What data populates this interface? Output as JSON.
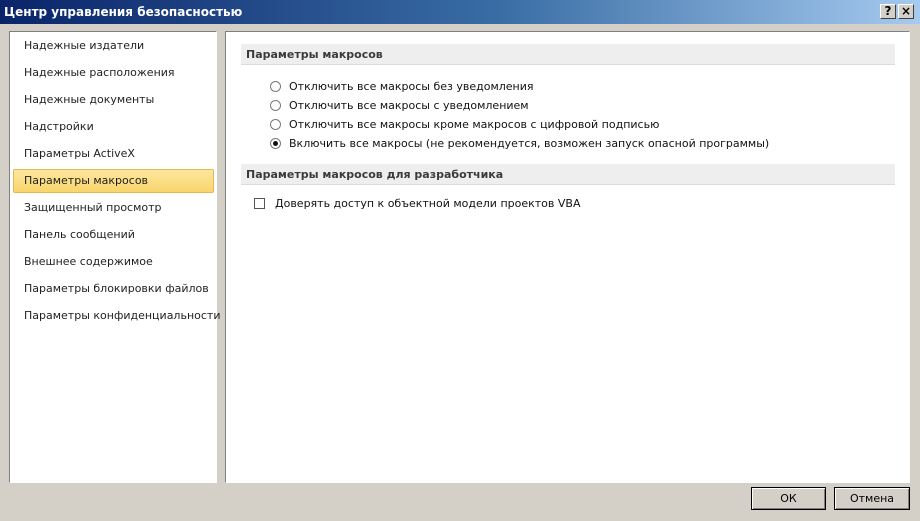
{
  "window": {
    "title": "Центр управления безопасностью",
    "help_label": "?",
    "close_label": "×"
  },
  "sidebar": {
    "items": [
      {
        "label": "Надежные издатели"
      },
      {
        "label": "Надежные расположения"
      },
      {
        "label": "Надежные документы"
      },
      {
        "label": "Надстройки"
      },
      {
        "label": "Параметры ActiveX"
      },
      {
        "label": "Параметры макросов",
        "selected": true
      },
      {
        "label": "Защищенный просмотр"
      },
      {
        "label": "Панель сообщений"
      },
      {
        "label": "Внешнее содержимое"
      },
      {
        "label": "Параметры блокировки файлов"
      },
      {
        "label": "Параметры конфиденциальности"
      }
    ]
  },
  "macro_settings": {
    "header": "Параметры макросов",
    "options": [
      {
        "label": "Отключить все макросы без уведомления",
        "checked": false
      },
      {
        "label": "Отключить все макросы с уведомлением",
        "checked": false
      },
      {
        "label": "Отключить все макросы кроме макросов с цифровой подписью",
        "checked": false
      },
      {
        "label": "Включить все макросы (не рекомендуется, возможен запуск опасной программы)",
        "checked": true
      }
    ]
  },
  "developer_settings": {
    "header": "Параметры макросов для разработчика",
    "trust_vba_label": "Доверять доступ к объектной модели проектов VBA",
    "trust_vba_checked": false
  },
  "buttons": {
    "ok": "ОК",
    "cancel": "Отмена"
  }
}
